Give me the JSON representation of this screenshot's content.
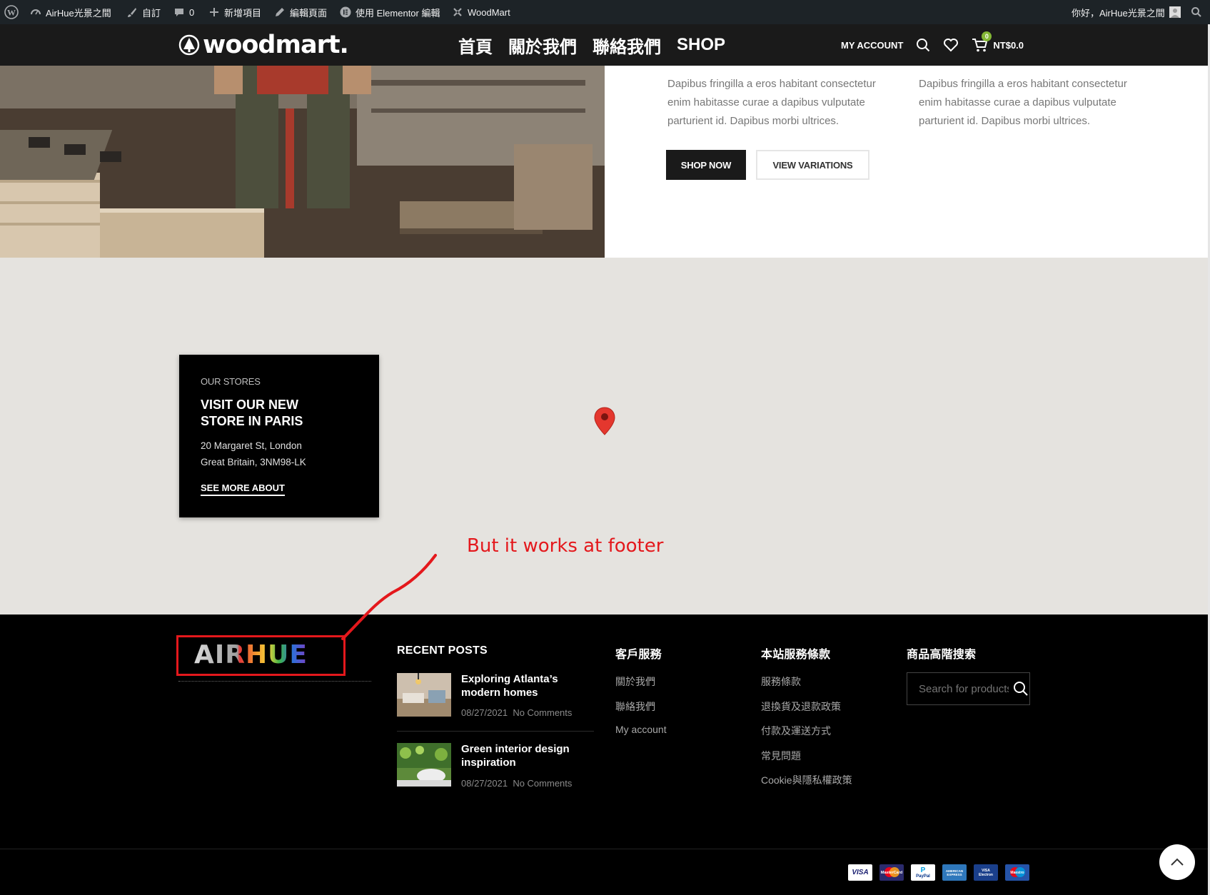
{
  "admin_bar": {
    "site_name": "AirHue光景之間",
    "customize": "自訂",
    "comments_count": "0",
    "new_item": "新增項目",
    "edit_page": "編輯頁面",
    "elementor_edit": "使用 Elementor 編輯",
    "theme": "WoodMart",
    "greeting": "你好，AirHue光景之間"
  },
  "header": {
    "logo_text": "woodmart.",
    "nav": [
      "首頁",
      "關於我們",
      "聯絡我們",
      "SHOP"
    ],
    "my_account": "MY ACCOUNT",
    "cart_count": "0",
    "cart_total": "NT$0.0"
  },
  "hero": {
    "text_col1": "Dapibus fringilla a eros habitant consectetur enim habitasse curae a dapibus vulputate parturient id. Dapibus morbi ultrices.",
    "text_col2": "Dapibus fringilla a eros habitant consectetur enim habitasse curae a dapibus vulputate parturient id. Dapibus morbi ultrices.",
    "shop_now": "SHOP NOW",
    "view_variations": "VIEW VARIATIONS"
  },
  "store": {
    "eyebrow": "OUR STORES",
    "title_line1": "VISIT OUR NEW",
    "title_line2": "STORE IN PARIS",
    "address_line1": "20 Margaret St, London",
    "address_line2": "Great Britain, 3NM98-LK",
    "link": "SEE MORE ABOUT"
  },
  "annotation": {
    "text": "But it works at footer",
    "color": "#e4181c"
  },
  "footer": {
    "brand_logo_text": "AIRHUE",
    "recent_posts": {
      "title": "RECENT POSTS",
      "posts": [
        {
          "title": "Exploring Atlanta’s modern homes",
          "date": "08/27/2021",
          "comments": "No Comments"
        },
        {
          "title": "Green interior design inspiration",
          "date": "08/27/2021",
          "comments": "No Comments"
        }
      ]
    },
    "customer_service": {
      "title": "客戶服務",
      "links": [
        "關於我們",
        "聯絡我們",
        "My account"
      ]
    },
    "terms": {
      "title": "本站服務條款",
      "links": [
        "服務條款",
        "退換貨及退款政策",
        "付款及運送方式",
        "常見問題",
        "Cookie與隱私權政策"
      ]
    },
    "search": {
      "title": "商品高階搜索",
      "placeholder": "Search for products"
    },
    "payments": [
      "VISA",
      "MasterCard",
      "PayPal",
      "AMERICAN EXPRESS",
      "VISA Electron",
      "Maestro"
    ]
  }
}
